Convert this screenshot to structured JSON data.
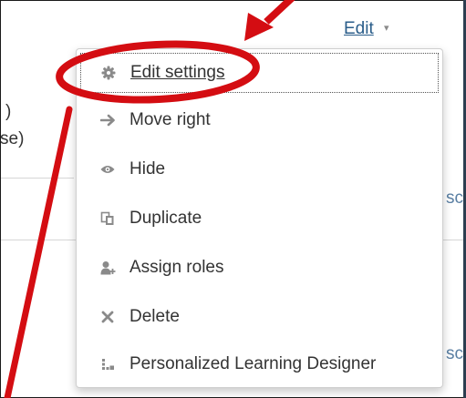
{
  "header": {
    "edit_label": "Edit",
    "caret": "▾"
  },
  "background": {
    "left_top_fragment": ")",
    "left_fragment": "se)",
    "right_fragment_1": "sc",
    "right_fragment_2": "sc"
  },
  "menu": {
    "items": [
      {
        "label": "Edit settings",
        "icon": "gear-icon"
      },
      {
        "label": "Move right",
        "icon": "arrow-right-icon"
      },
      {
        "label": "Hide",
        "icon": "eye-icon"
      },
      {
        "label": "Duplicate",
        "icon": "duplicate-icon"
      },
      {
        "label": "Assign roles",
        "icon": "assign-roles-icon"
      },
      {
        "label": "Delete",
        "icon": "close-icon"
      },
      {
        "label": "Personalized Learning Designer",
        "icon": "pld-icon"
      }
    ]
  },
  "colors": {
    "annotation_red": "#d40d12",
    "link_blue": "#2a5d8a",
    "icon_gray": "#8a8a8a"
  }
}
